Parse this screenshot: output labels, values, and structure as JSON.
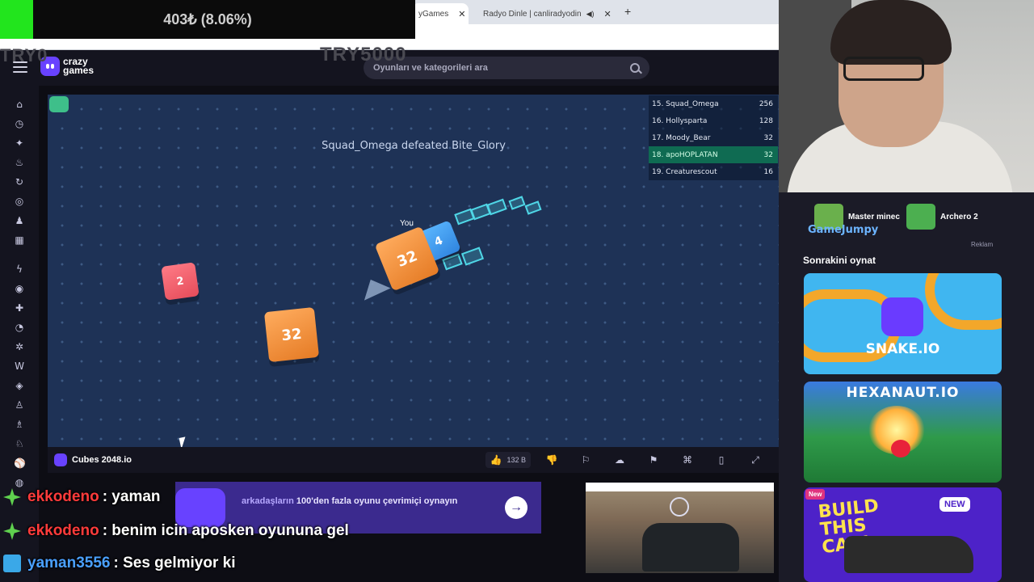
{
  "donation": {
    "text": "403₺ (8.06%)",
    "progress_percent": 8.06
  },
  "overlay_left": "TRY0",
  "overlay_right": "TRY5000",
  "browser": {
    "tabs": [
      {
        "label": "yGames",
        "active": true
      },
      {
        "label": "Radyo Dinle | canliradyodin",
        "active": false
      }
    ]
  },
  "header": {
    "logo_line1": "crazy",
    "logo_line2": "games",
    "search_placeholder": "Oyunları ve kategorileri ara"
  },
  "sidebar": {
    "icons": [
      "home-icon",
      "clock-icon",
      "sparkle-icon",
      "fire-icon",
      "refresh-icon",
      "controller-icon",
      "users-icon",
      "blocks-icon",
      "bolt-icon",
      "target-icon",
      "puzzle-icon",
      "pacman-icon",
      "gear-icon",
      "w-icon",
      "compass-icon",
      "person-icon",
      "person-alt-icon",
      "person-run-icon",
      "ball-icon",
      "globe-icon"
    ]
  },
  "game": {
    "kill_message": "Squad_Omega defeated Bite_Glory",
    "you_label": "You",
    "cubes": {
      "player_value": "32",
      "player_trail_value": "4",
      "red_value": "2",
      "orange_value": "32"
    },
    "leaderboard": [
      {
        "name": "15. Squad_Omega",
        "score": "256",
        "me": false
      },
      {
        "name": "16. Hollysparta",
        "score": "128",
        "me": false
      },
      {
        "name": "17. Moody_Bear",
        "score": "32",
        "me": false
      },
      {
        "name": "18. apoHOPLATAN",
        "score": "32",
        "me": true
      },
      {
        "name": "19. Creaturescout",
        "score": "16",
        "me": false
      }
    ]
  },
  "footer": {
    "title": "Cubes 2048.io",
    "likes": "132 B"
  },
  "promo": {
    "highlight": "arkadaşların",
    "text": "100'den fazla oyunu çevrimiçi oynayın",
    "button": "→"
  },
  "right_panel": {
    "items": [
      {
        "label": "Master minec",
        "color": "#6ab04c"
      },
      {
        "label": "Archero 2",
        "color": "#4caf50"
      }
    ],
    "gamejumpy": "GameJumpy",
    "ad_label": "Reklam",
    "next_title": "Sonrakini oynat",
    "cards": {
      "snake": "SNAKE.IO",
      "hexanaut": "HEXANAUT.IO",
      "build": {
        "badge": "New",
        "title": "BUILD THIS CAR!",
        "tag": "NEW"
      }
    }
  },
  "chat": [
    {
      "user": "ekkodeno",
      "message": ": yaman",
      "user_color": "#ff3b3b",
      "badge": "green"
    },
    {
      "user": "ekkodeno",
      "message": ": benim icin aposken oyununa gel",
      "user_color": "#ff3b3b",
      "badge": "green"
    },
    {
      "user": "yaman3556",
      "message": ": Ses gelmiyor ki",
      "user_color": "#4aa0ff",
      "badge": "blue"
    }
  ]
}
